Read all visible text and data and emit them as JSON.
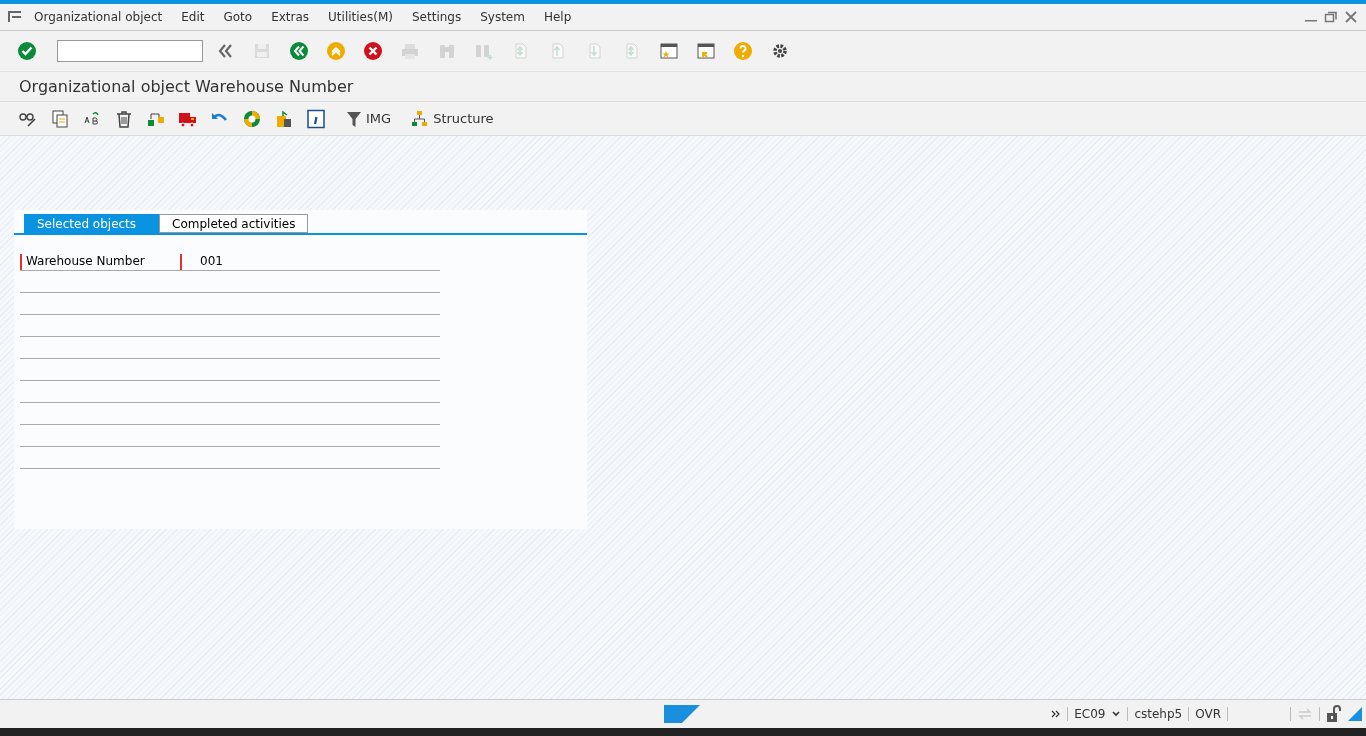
{
  "menu": [
    "Organizational object",
    "Edit",
    "Goto",
    "Extras",
    "Utilities(M)",
    "Settings",
    "System",
    "Help"
  ],
  "toolbar": {
    "buttons": [
      {
        "disabled": false
      },
      {
        "disabled": false
      },
      {
        "disabled": true
      },
      {
        "disabled": false
      },
      {
        "disabled": false
      },
      {
        "disabled": false
      },
      {
        "disabled": true
      },
      {
        "disabled": true
      },
      {
        "disabled": true
      },
      {
        "disabled": true
      },
      {
        "disabled": true
      },
      {
        "disabled": true
      },
      {
        "disabled": true
      },
      {
        "disabled": false
      },
      {
        "disabled": false
      },
      {
        "disabled": false
      },
      {
        "disabled": false
      }
    ]
  },
  "title": "Organizational object Warehouse Number",
  "app_toolbar": {
    "img_label": "IMG",
    "structure_label": "Structure"
  },
  "tabs": [
    {
      "label": "Selected objects",
      "selected": true
    },
    {
      "label": "Completed activities",
      "selected": false
    }
  ],
  "fields": [
    {
      "label": "Warehouse Number",
      "value": "001"
    }
  ],
  "status_bar": {
    "system": "EC09",
    "server": "cstehp5",
    "mode": "OVR"
  }
}
